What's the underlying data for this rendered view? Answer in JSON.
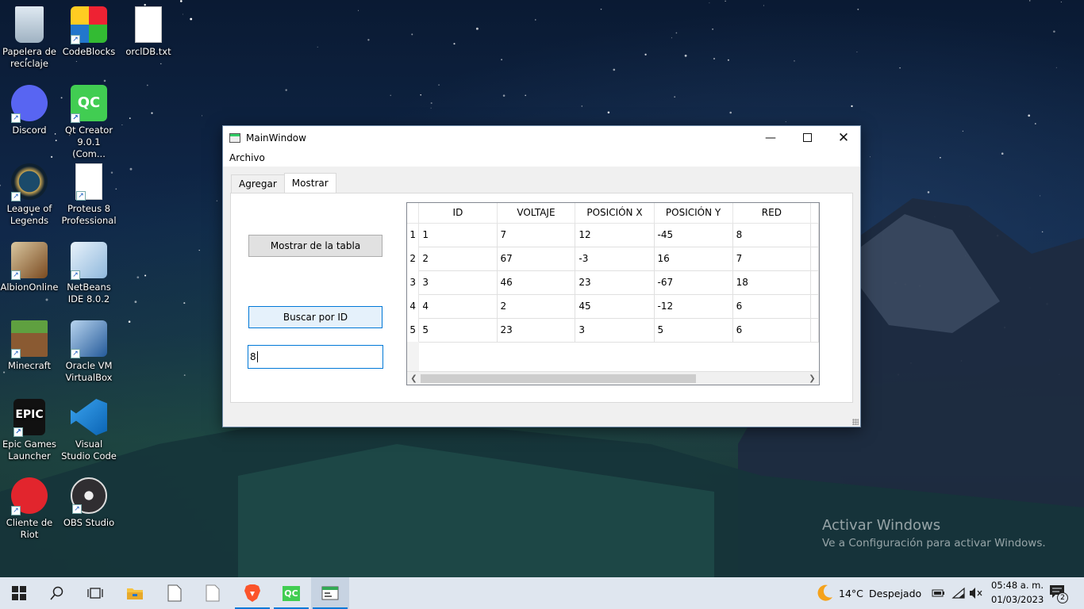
{
  "desktop": {
    "icons": [
      {
        "label": "Papelera de reciclaje",
        "icon": "recycle-bin-icon"
      },
      {
        "label": "CodeBlocks",
        "icon": "codeblocks-icon"
      },
      {
        "label": "orclDB.txt",
        "icon": "text-file-icon"
      },
      {
        "label": "Discord",
        "icon": "discord-icon"
      },
      {
        "label": "Qt Creator 9.0.1 (Com...",
        "icon": "qt-creator-icon"
      },
      {
        "label": "League of Legends",
        "icon": "league-of-legends-icon"
      },
      {
        "label": "Proteus 8 Professional",
        "icon": "proteus-icon"
      },
      {
        "label": "AlbionOnline",
        "icon": "albion-online-icon"
      },
      {
        "label": "NetBeans IDE 8.0.2",
        "icon": "netbeans-icon"
      },
      {
        "label": "Minecraft",
        "icon": "minecraft-icon"
      },
      {
        "label": "Oracle VM VirtualBox",
        "icon": "virtualbox-icon"
      },
      {
        "label": "Epic Games Launcher",
        "icon": "epic-games-icon"
      },
      {
        "label": "Visual Studio Code",
        "icon": "vscode-icon"
      },
      {
        "label": "Cliente de Riot",
        "icon": "riot-client-icon"
      },
      {
        "label": "OBS Studio",
        "icon": "obs-studio-icon"
      }
    ],
    "watermark": {
      "title": "Activar Windows",
      "subtitle": "Ve a Configuración para activar Windows."
    }
  },
  "window": {
    "title": "MainWindow",
    "menu": [
      "Archivo"
    ],
    "tabs": [
      "Agregar",
      "Mostrar"
    ],
    "active_tab": "Mostrar",
    "buttons": {
      "show_table": "Mostrar de la tabla",
      "search_id": "Buscar por ID"
    },
    "id_input_value": "8",
    "table": {
      "columns": [
        "ID",
        "VOLTAJE",
        "POSICIÓN X",
        "POSICIÓN Y",
        "RED"
      ],
      "row_headers": [
        "1",
        "2",
        "3",
        "4",
        "5"
      ],
      "rows": [
        [
          "1",
          "7",
          "12",
          "-45",
          "8"
        ],
        [
          "2",
          "67",
          "-3",
          "16",
          "7"
        ],
        [
          "3",
          "46",
          "23",
          "-67",
          "18"
        ],
        [
          "4",
          "2",
          "45",
          "-12",
          "6"
        ],
        [
          "5",
          "23",
          "3",
          "5",
          "6"
        ]
      ]
    }
  },
  "taskbar": {
    "weather": {
      "temp": "14°C",
      "condition": "Despejado"
    },
    "time": "05:48 a. m.",
    "date": "01/03/2023",
    "notifications": "2"
  },
  "colors": {
    "accent": "#0078d7",
    "taskbar": "#dfe6ef"
  }
}
